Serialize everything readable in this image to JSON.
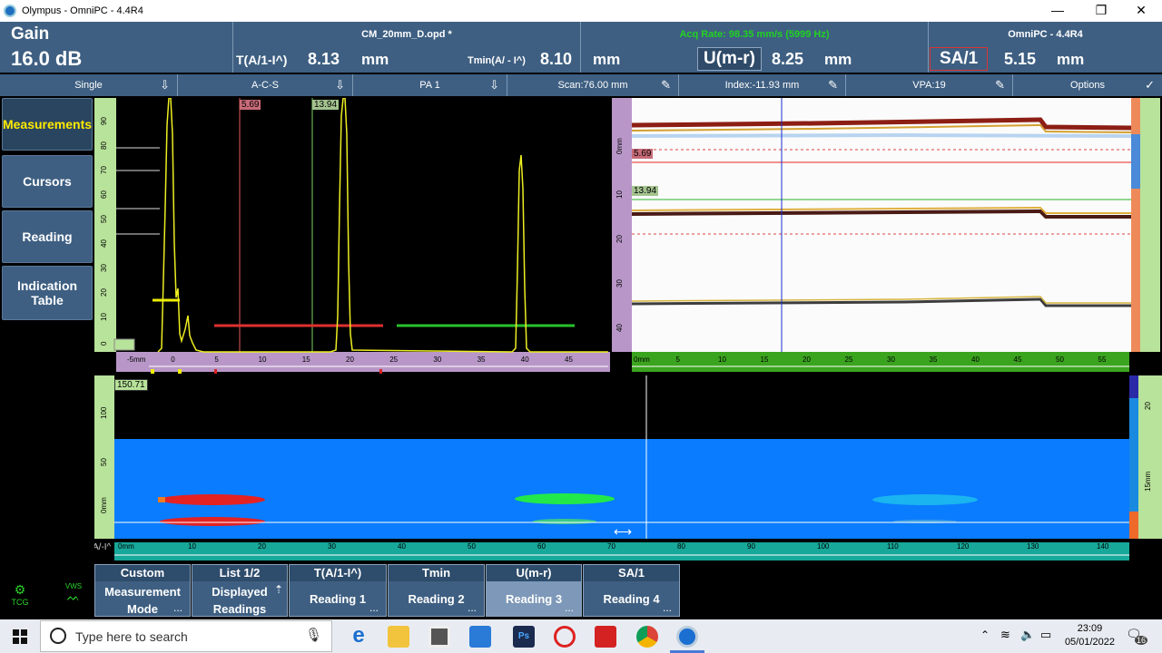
{
  "window": {
    "title": "Olympus - OmniPC - 4.4R4",
    "minimize": "—",
    "maximize": "❐",
    "close": "✕"
  },
  "header": {
    "gain_label": "Gain",
    "gain_value": "16.0 dB",
    "file_name": "CM_20mm_D.opd *",
    "acq_rate": "Acq Rate: 98.35 mm/s (5999 Hz)",
    "app_version": "OmniPC - 4.4R4",
    "readings": [
      {
        "label": "T(A/1-I^)",
        "value": "8.13",
        "unit": "mm"
      },
      {
        "label": "Tmin(A/ - I^)",
        "value": "8.10",
        "unit": "mm"
      },
      {
        "label": "U(m-r)",
        "value": "8.25",
        "unit": "mm"
      },
      {
        "label": "SA/1",
        "value": "5.15",
        "unit": "mm"
      }
    ]
  },
  "toolbar": {
    "items": [
      {
        "label": "Single",
        "icon": "arrow-down-icon"
      },
      {
        "label": "A-C-S",
        "icon": "arrow-down-icon"
      },
      {
        "label": "PA 1",
        "icon": "arrow-down-icon"
      },
      {
        "label": "Scan:76.00 mm",
        "icon": "pencil-icon"
      },
      {
        "label": "Index:-11.93 mm",
        "icon": "pencil-icon"
      },
      {
        "label": "VPA:19",
        "icon": "pencil-icon"
      },
      {
        "label": "Options",
        "icon": "check-icon"
      }
    ]
  },
  "side_menu": [
    {
      "label": "Measurements",
      "active": true
    },
    {
      "label": "Cursors",
      "active": false
    },
    {
      "label": "Reading",
      "active": false
    },
    {
      "label": "Indication Table",
      "active": false
    }
  ],
  "ascan": {
    "cursor_ref_tag": "5.69",
    "cursor_meas_tag": "13.94",
    "x_ticks": [
      "-5mm",
      "0",
      "5",
      "10",
      "15",
      "20",
      "25",
      "30",
      "35",
      "40",
      "45"
    ],
    "y_ticks": [
      "90",
      "80",
      "70",
      "60",
      "50",
      "40",
      "30",
      "20",
      "10",
      "0"
    ]
  },
  "bscan": {
    "cursor_ref_tag": "5.69",
    "cursor_meas_tag": "13.94",
    "x_ticks": [
      "0mm",
      "5",
      "10",
      "15",
      "20",
      "25",
      "30",
      "35",
      "40",
      "45",
      "50",
      "55"
    ],
    "y_ticks": [
      "0mm",
      "10",
      "20",
      "30",
      "40"
    ]
  },
  "cscan": {
    "value_tag": "150.71",
    "axis_label": "A/-I^",
    "x_ticks": [
      "0mm",
      "10",
      "20",
      "30",
      "40",
      "50",
      "60",
      "70",
      "80",
      "90",
      "100",
      "110",
      "120",
      "130",
      "140"
    ],
    "y_ticks": [
      "100",
      "50",
      "0mm"
    ],
    "right_ticks": [
      "20",
      "15mm"
    ]
  },
  "bottom_bar": [
    {
      "caption": "Custom",
      "label": "Measurement Mode",
      "dots": "...",
      "active": false
    },
    {
      "caption": "List 1/2",
      "label": "Displayed Readings",
      "dots": "⇡",
      "active": false
    },
    {
      "caption": "T(A/1-I^)",
      "label": "Reading 1",
      "dots": "...",
      "active": false
    },
    {
      "caption": "Tmin",
      "label": "Reading 2",
      "dots": "...",
      "active": false
    },
    {
      "caption": "U(m-r)",
      "label": "Reading 3",
      "dots": "...",
      "active": true
    },
    {
      "caption": "SA/1",
      "label": "Reading 4",
      "dots": "...",
      "active": false
    }
  ],
  "status_icons": {
    "left": "TCG",
    "right": "VWS"
  },
  "taskbar": {
    "search_placeholder": "Type here to search",
    "time": "23:09",
    "date": "05/01/2022",
    "notification_count": "16"
  },
  "colors": {
    "header_bg": "#3e5f82",
    "active_text": "#ffea00",
    "acq_text": "#21d321",
    "cscan_bg": "#0a7cff"
  }
}
